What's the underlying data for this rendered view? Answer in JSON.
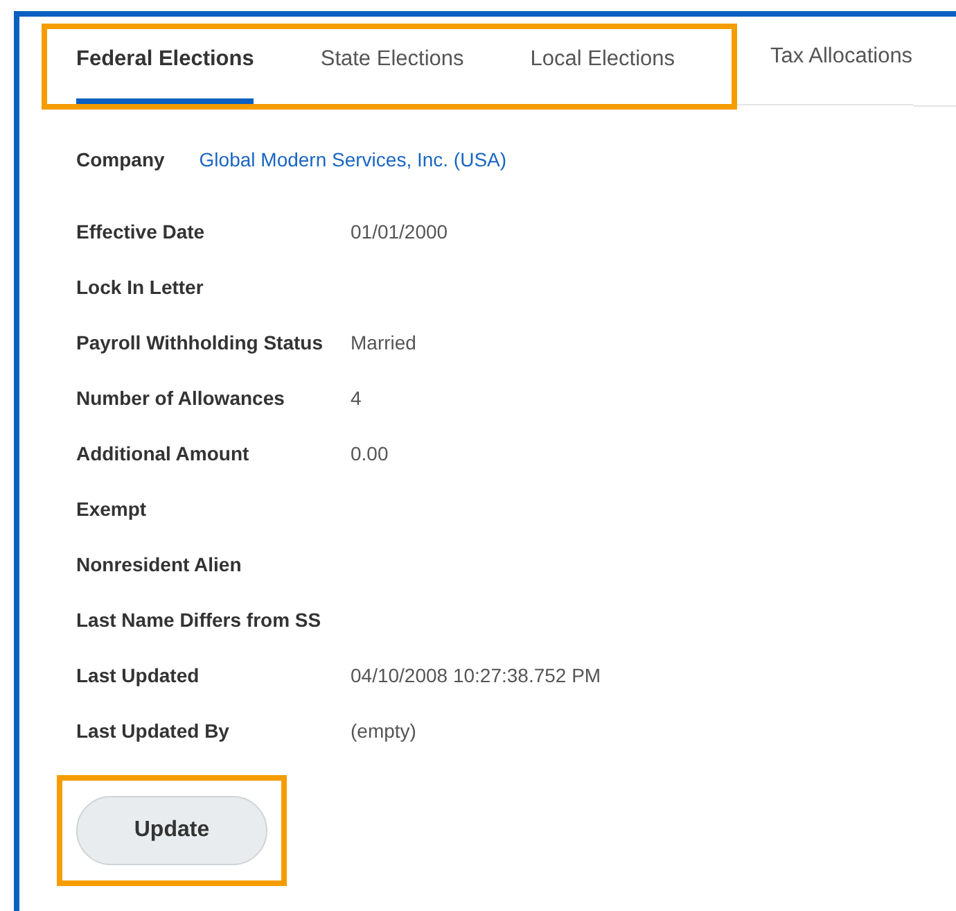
{
  "tabs": [
    {
      "label": "Federal Elections",
      "selected": true,
      "highlighted": true
    },
    {
      "label": "State Elections",
      "selected": false,
      "highlighted": true
    },
    {
      "label": "Local Elections",
      "selected": false,
      "highlighted": true
    },
    {
      "label": "Tax Allocations",
      "selected": false,
      "highlighted": false
    }
  ],
  "company": {
    "label": "Company",
    "value": "Global Modern Services, Inc. (USA)"
  },
  "fields": [
    {
      "label": "Effective Date",
      "value": "01/01/2000"
    },
    {
      "label": "Lock In Letter"
    },
    {
      "label": "Payroll Withholding Status",
      "value": "Married"
    },
    {
      "label": "Number of Allowances",
      "value": "4"
    },
    {
      "label": "Additional Amount",
      "value": "0.00"
    },
    {
      "label": "Exempt"
    },
    {
      "label": "Nonresident Alien"
    },
    {
      "label": "Last Name Differs from SS"
    },
    {
      "label": "Last Updated",
      "value": "04/10/2008 10:27:38.752 PM"
    },
    {
      "label": "Last Updated By",
      "value": "(empty)"
    }
  ],
  "update_button": {
    "label": "Update",
    "highlighted": true
  }
}
